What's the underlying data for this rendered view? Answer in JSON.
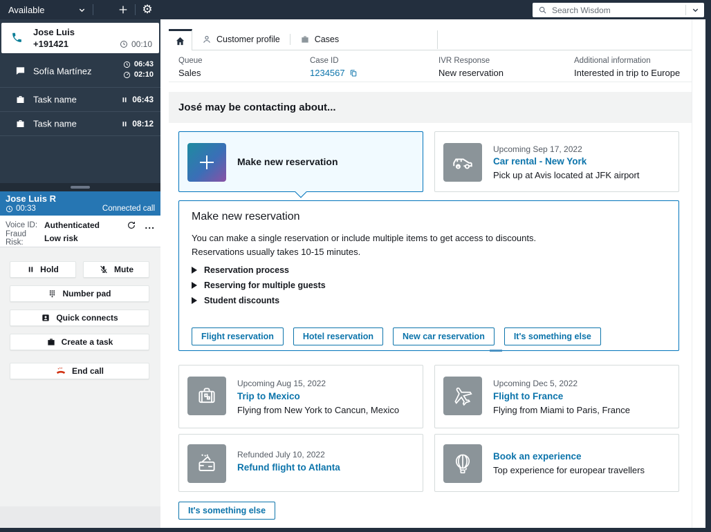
{
  "topbar": {
    "status": "Available",
    "search_placeholder": "Search Wisdom"
  },
  "sidebar": {
    "active_contact": {
      "name": "Jose Luis",
      "phone": "+191421",
      "timer": "00:10"
    },
    "chat_contact": {
      "name": "Sofía Martínez",
      "timer1": "06:43",
      "timer2": "02:10"
    },
    "tasks": [
      {
        "name": "Task name",
        "timer": "06:43"
      },
      {
        "name": "Task name",
        "timer": "08:12"
      }
    ],
    "connected": {
      "name": "Jose Luis R",
      "timer": "00:33",
      "status": "Connected call"
    },
    "voice": {
      "voice_id_label": "Voice ID:",
      "voice_id_value": "Authenticated",
      "fraud_label": "Fraud Risk:",
      "fraud_value": "Low risk",
      "ellipsis": "..."
    },
    "controls": {
      "hold": "Hold",
      "mute": "Mute",
      "number_pad": "Number pad",
      "quick_connects": "Quick connects",
      "create_task": "Create a task",
      "end_call": "End call"
    }
  },
  "tabs": {
    "customer_profile": "Customer profile",
    "cases": "Cases"
  },
  "case_info": {
    "fields": [
      {
        "label": "Queue",
        "value": "Sales"
      },
      {
        "label": "Case ID",
        "value": "1234567"
      },
      {
        "label": "IVR Response",
        "value": "New reservation"
      },
      {
        "label": "Additional information",
        "value": "Interested in trip to Europe"
      }
    ]
  },
  "main": {
    "heading": "José may be contacting about...",
    "selected_card": {
      "title": "Make new reservation"
    },
    "cards": [
      {
        "meta": "Upcoming Sep 17, 2022",
        "title": "Car rental - New York",
        "desc": "Pick up at Avis located at JFK airport"
      },
      {
        "meta": "Upcoming Aug 15, 2022",
        "title": "Trip to Mexico",
        "desc": "Flying from New York to Cancun, Mexico"
      },
      {
        "meta": "Upcoming Dec 5, 2022",
        "title": "Flight to France",
        "desc": "Flying from Miami to Paris, France"
      },
      {
        "meta": "Refunded July 10, 2022",
        "title": "Refund flight to Atlanta"
      },
      {
        "title": "Book an experience",
        "desc": "Top experience for europear travellers"
      }
    ],
    "panel": {
      "title": "Make new reservation",
      "body1": "You can make a single reservation or include multiple items to get access to discounts.",
      "body2": "Reservations usually takes 10-15 minutes.",
      "accordions": [
        "Reservation process",
        "Reserving for multiple guests",
        "Student discounts"
      ],
      "buttons": [
        "Flight reservation",
        "Hotel reservation",
        "New car reservation",
        "It's something else"
      ]
    },
    "something_else": "It's something else"
  },
  "colors": {
    "dark_navy": "#232f3e",
    "accent_blue": "#0073bb",
    "connected_blue": "#2676b3",
    "selected_card_bg": "#f1faff",
    "tile_gray": "#8b9499",
    "end_call_red": "#d13212",
    "phone_teal": "#0d7f98"
  }
}
